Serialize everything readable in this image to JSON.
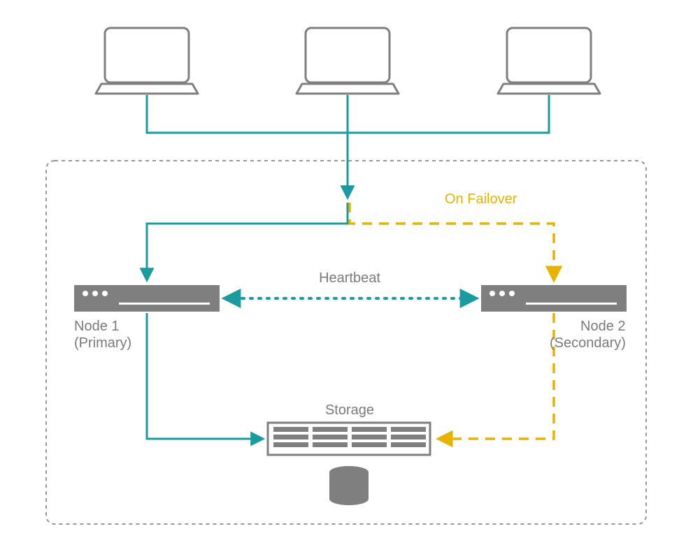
{
  "labels": {
    "failover": "On Failover",
    "heartbeat": "Heartbeat",
    "node1_line1": "Node 1",
    "node1_line2": "(Primary)",
    "node2_line1": "Node 2",
    "node2_line2": "(Secondary)",
    "storage": "Storage"
  },
  "colors": {
    "line_gray": "#7f7f7f",
    "fill_gray": "#7f7f7f",
    "teal": "#1a9ba0",
    "yellow": "#e8b200",
    "text": "#7a7a7a"
  },
  "diagram": {
    "clients": 3,
    "cluster_nodes": 2,
    "storage": 1,
    "links": [
      {
        "from": "clients",
        "to": "cluster",
        "style": "teal-solid"
      },
      {
        "from": "cluster-entry",
        "to": "node1",
        "style": "teal-solid",
        "role": "primary-path"
      },
      {
        "from": "cluster-entry",
        "to": "node2",
        "style": "yellow-dashed",
        "role": "failover-path"
      },
      {
        "from": "node1",
        "to": "node2",
        "style": "teal-dotted",
        "role": "heartbeat",
        "bidirectional": true
      },
      {
        "from": "node1",
        "to": "storage",
        "style": "teal-solid"
      },
      {
        "from": "node2",
        "to": "storage",
        "style": "yellow-dashed"
      }
    ]
  }
}
